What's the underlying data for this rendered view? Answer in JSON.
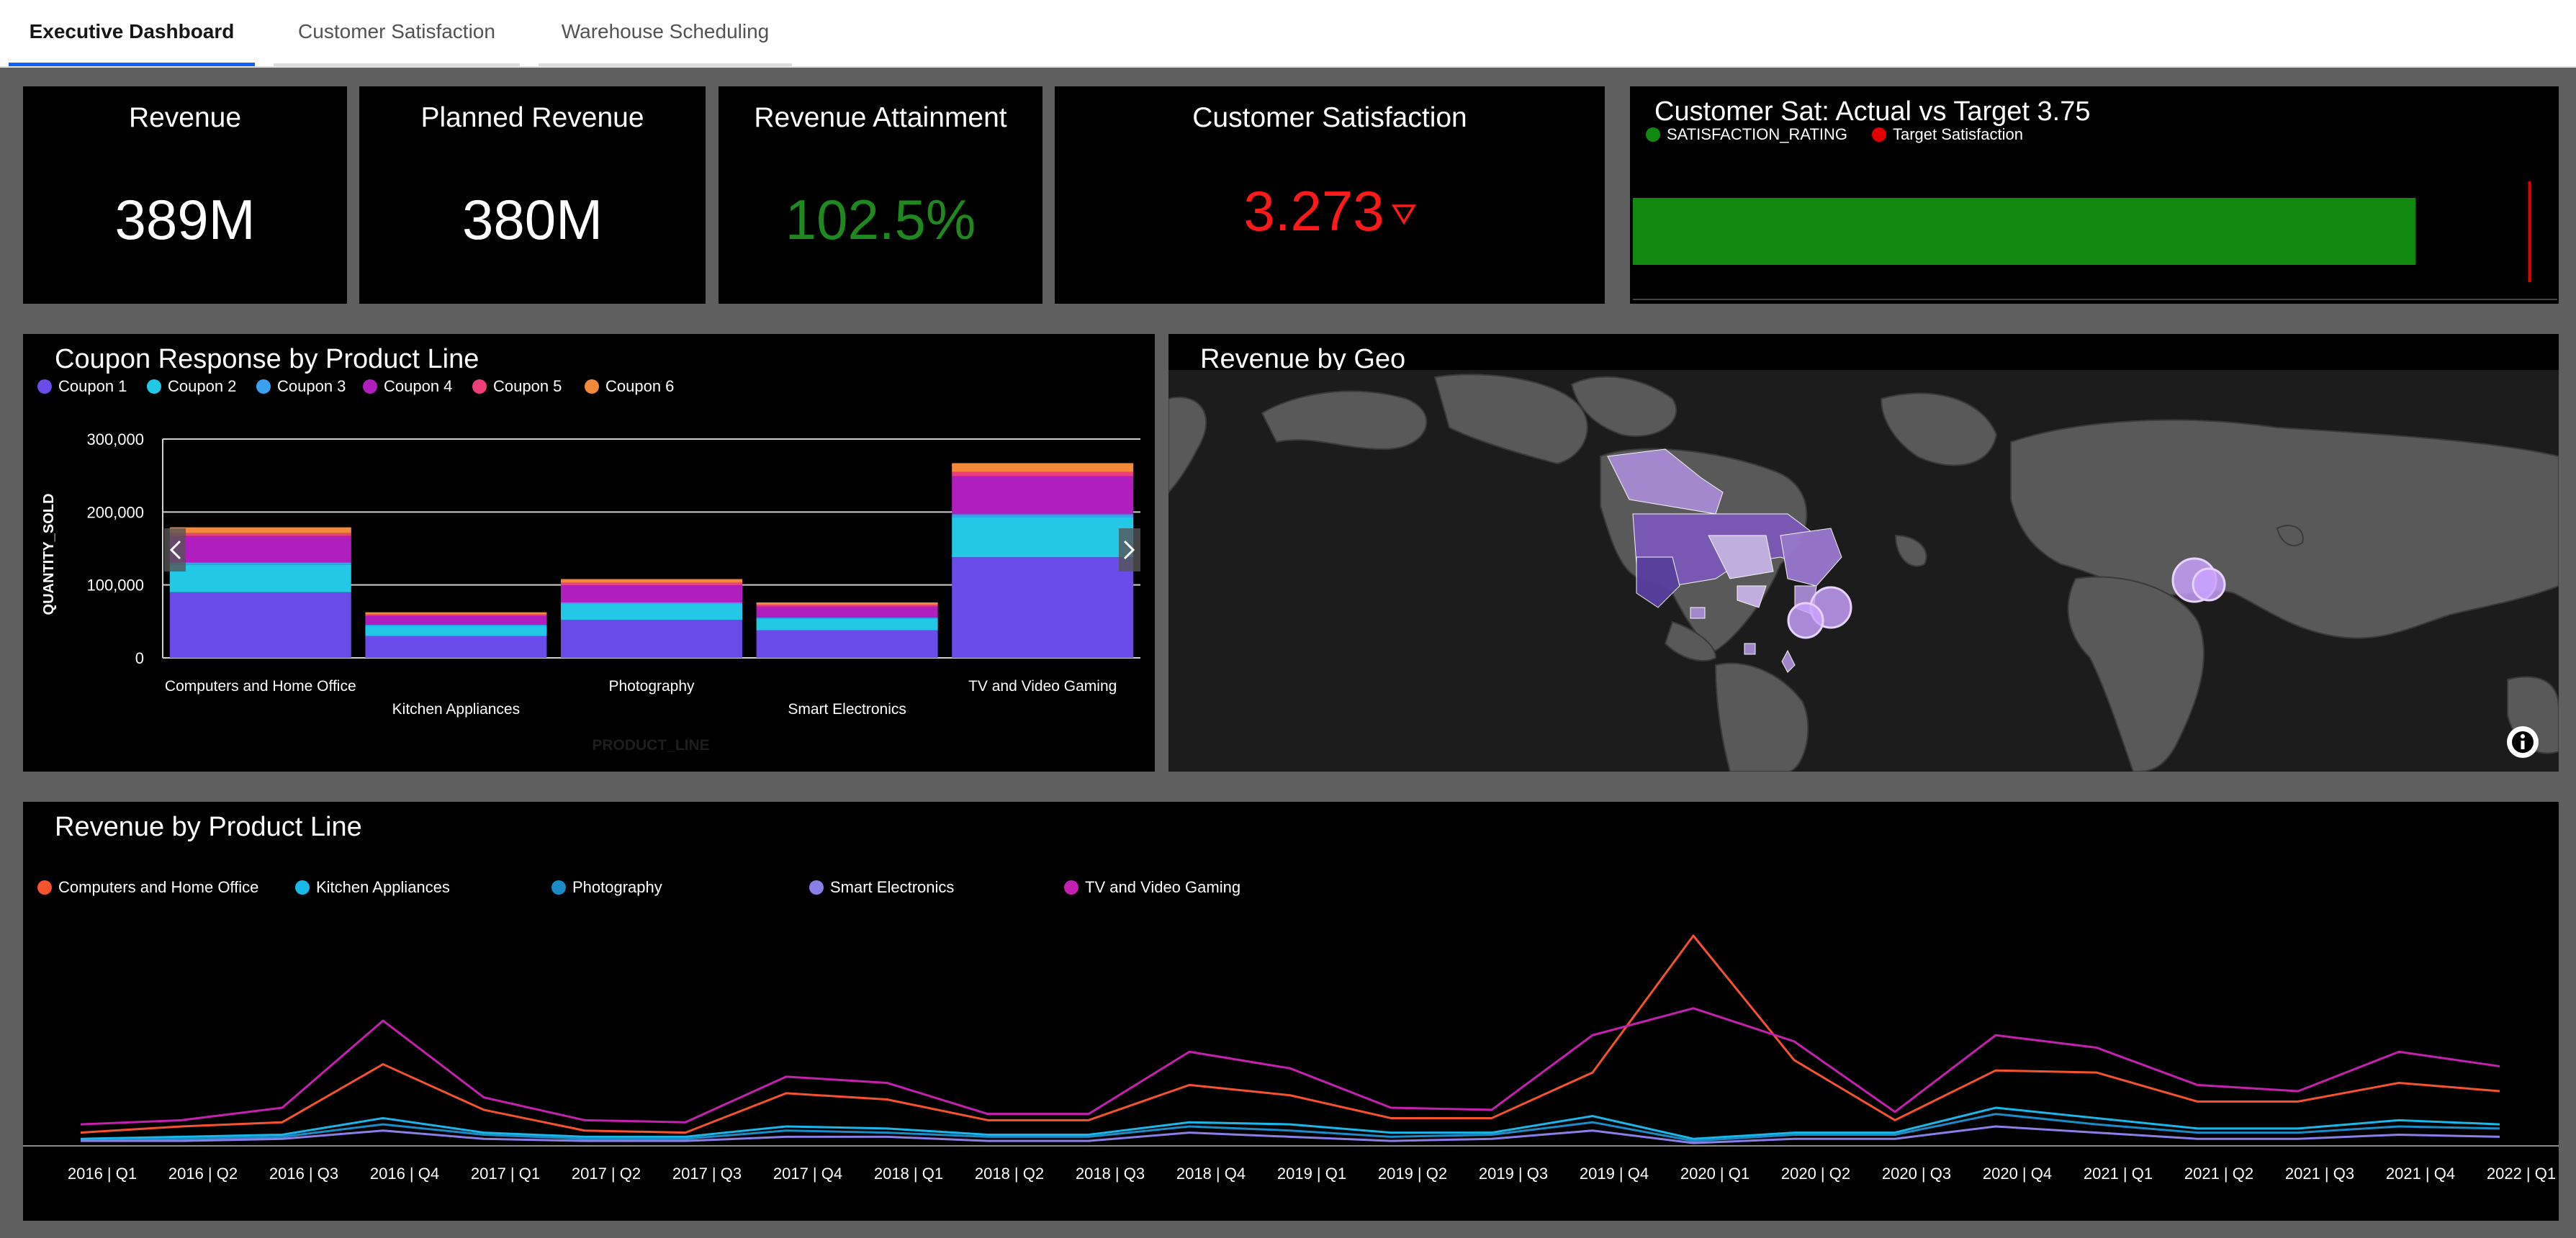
{
  "tabs": [
    {
      "label": "Executive Dashboard",
      "active": true
    },
    {
      "label": "Customer Satisfaction",
      "active": false
    },
    {
      "label": "Warehouse Scheduling",
      "active": false
    }
  ],
  "kpis": {
    "revenue": {
      "title": "Revenue",
      "value": "389M"
    },
    "planned": {
      "title": "Planned Revenue",
      "value": "380M"
    },
    "attainment": {
      "title": "Revenue Attainment",
      "value": "102.5%",
      "color": "#1e8a1e"
    },
    "satisfaction": {
      "title": "Customer Satisfaction",
      "value": "3.273",
      "trend_icon": "down-triangle-outline",
      "color": "#ff1a1a"
    }
  },
  "bullet": {
    "title": "Customer Sat: Actual vs Target 3.75",
    "legend": [
      {
        "label": "SATISFACTION_RATING",
        "color": "#0f8a0f"
      },
      {
        "label": "Target Satisfaction",
        "color": "#e00000"
      }
    ],
    "actual": 3.273,
    "target": 3.75
  },
  "coupon": {
    "title": "Coupon Response by Product Line",
    "chart_data": {
      "type": "bar",
      "stacked": true,
      "ylabel": "QUANTITY_SOLD",
      "xlabel": "PRODUCT_LINE",
      "ylim": [
        0,
        300000
      ],
      "yticks": [
        "0",
        "100,000",
        "200,000",
        "300,000"
      ],
      "yticks_values": [
        0,
        100000,
        200000,
        300000
      ],
      "categories": [
        "Computers and Home Office",
        "Kitchen Appliances",
        "Photography",
        "Smart Electronics",
        "TV and Video Gaming"
      ],
      "series": [
        {
          "name": "Coupon 1",
          "color": "#6a4de8",
          "values": [
            90000,
            30000,
            52000,
            38000,
            138000
          ]
        },
        {
          "name": "Coupon 2",
          "color": "#22c8e6",
          "values": [
            38000,
            14000,
            22000,
            16000,
            55000
          ]
        },
        {
          "name": "Coupon 3",
          "color": "#3aa0f0",
          "values": [
            3000,
            1500,
            2000,
            1500,
            4000
          ]
        },
        {
          "name": "Coupon 4",
          "color": "#b01fbd",
          "values": [
            36000,
            12000,
            24000,
            15000,
            52000
          ]
        },
        {
          "name": "Coupon 5",
          "color": "#f03e7a",
          "values": [
            4000,
            2000,
            3000,
            2500,
            6000
          ]
        },
        {
          "name": "Coupon 6",
          "color": "#f5893b",
          "values": [
            8000,
            3000,
            5000,
            3000,
            12000
          ]
        }
      ]
    }
  },
  "geo": {
    "title": "Revenue by Geo",
    "info_icon": "info-icon"
  },
  "trend": {
    "title": "Revenue by Product Line",
    "chart_data": {
      "type": "line",
      "x": [
        "2016 | Q1",
        "2016 | Q2",
        "2016 | Q3",
        "2016 | Q4",
        "2017 | Q1",
        "2017 | Q2",
        "2017 | Q3",
        "2017 | Q4",
        "2018 | Q1",
        "2018 | Q2",
        "2018 | Q3",
        "2018 | Q4",
        "2019 | Q1",
        "2019 | Q2",
        "2019 | Q3",
        "2019 | Q4",
        "2020 | Q1",
        "2020 | Q2",
        "2020 | Q3",
        "2020 | Q4",
        "2021 | Q1",
        "2021 | Q2",
        "2021 | Q3",
        "2021 | Q4",
        "2022 | Q1"
      ],
      "ylim": [
        0,
        100
      ],
      "series": [
        {
          "name": "Computers and Home Office",
          "color": "#f5532e",
          "values": [
            5,
            8,
            10,
            38,
            16,
            6,
            5,
            24,
            21,
            11,
            11,
            28,
            23,
            12,
            12,
            34,
            100,
            40,
            11,
            35,
            34,
            20,
            20,
            29,
            25
          ]
        },
        {
          "name": "Kitchen Appliances",
          "color": "#1ab8ea",
          "values": [
            2,
            3,
            4,
            12,
            5,
            3,
            3,
            8,
            7,
            4,
            4,
            10,
            9,
            5,
            5,
            13,
            2,
            5,
            5,
            17,
            12,
            7,
            7,
            11,
            9
          ]
        },
        {
          "name": "Photography",
          "color": "#1a8cc8",
          "values": [
            1,
            2,
            3,
            9,
            4,
            2,
            2,
            6,
            5,
            3,
            3,
            8,
            6,
            3,
            4,
            10,
            1,
            4,
            4,
            14,
            9,
            5,
            5,
            8,
            7
          ]
        },
        {
          "name": "Smart Electronics",
          "color": "#8a7fe8",
          "values": [
            1,
            1,
            2,
            6,
            2,
            1,
            1,
            3,
            3,
            1,
            1,
            5,
            3,
            1,
            2,
            6,
            0,
            2,
            2,
            8,
            5,
            2,
            2,
            4,
            3
          ]
        },
        {
          "name": "TV and Video Gaming",
          "color": "#c520b0",
          "values": [
            9,
            11,
            17,
            59,
            22,
            11,
            10,
            32,
            29,
            14,
            14,
            44,
            36,
            17,
            16,
            52,
            65,
            49,
            15,
            52,
            46,
            28,
            25,
            44,
            37
          ]
        }
      ]
    }
  }
}
